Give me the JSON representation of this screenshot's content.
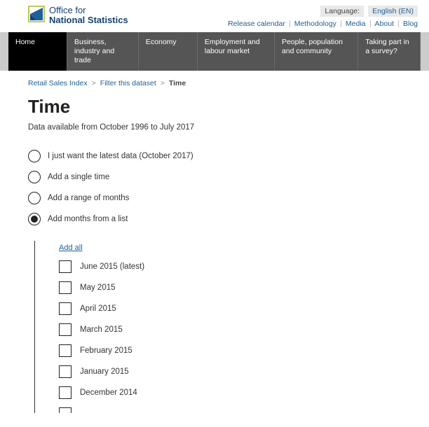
{
  "header": {
    "logo_line1": "Office for",
    "logo_line2": "National Statistics",
    "language_label": "Language:",
    "language_value": "English (EN)",
    "top_links": [
      "Release calendar",
      "Methodology",
      "Media",
      "About",
      "Blog"
    ]
  },
  "nav": {
    "items": [
      {
        "label": "Home",
        "active": true
      },
      {
        "label": "Business, industry and trade",
        "active": false
      },
      {
        "label": "Economy",
        "active": false
      },
      {
        "label": "Employment and labour market",
        "active": false
      },
      {
        "label": "People, population and community",
        "active": false
      },
      {
        "label": "Taking part in a survey?",
        "active": false
      }
    ]
  },
  "breadcrumb": {
    "items": [
      {
        "label": "Retail Sales Index",
        "link": true
      },
      {
        "label": "Filter this dataset",
        "link": true
      },
      {
        "label": "Time",
        "link": false
      }
    ],
    "sep": ">"
  },
  "page": {
    "title": "Time",
    "subtitle": "Data available from October 1996 to July 2017"
  },
  "radios": [
    {
      "label": "I just want the latest data (October 2017)",
      "selected": false
    },
    {
      "label": "Add a single time",
      "selected": false
    },
    {
      "label": "Add a range of months",
      "selected": false
    },
    {
      "label": "Add months from a list",
      "selected": true
    }
  ],
  "nested": {
    "add_all": "Add all",
    "months": [
      "June 2015 (latest)",
      "May 2015",
      "April 2015",
      "March 2015",
      "February 2015",
      "January 2015",
      "December 2014"
    ]
  }
}
